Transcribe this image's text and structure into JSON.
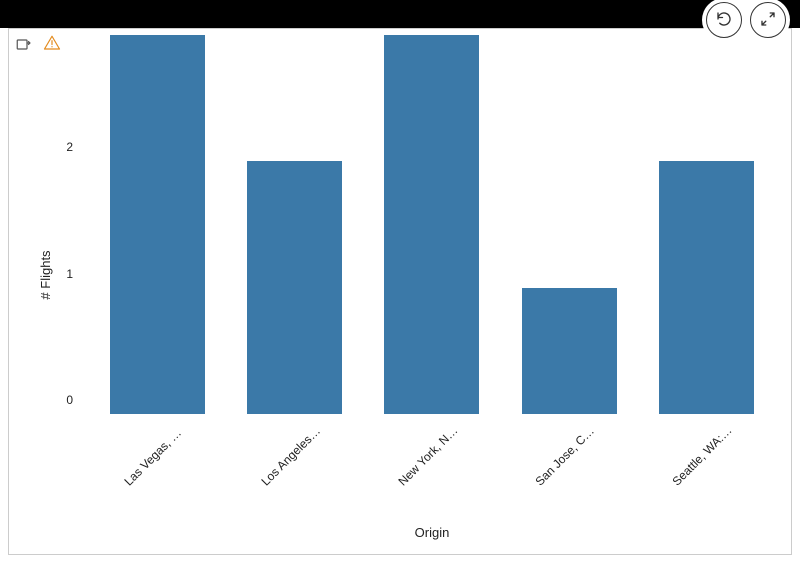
{
  "chart_data": {
    "type": "bar",
    "categories": [
      "Las Vegas, NV: McC...",
      "Los Angeles, CA: Lo...",
      "New York, NY: John ...",
      "San Jose, CA: Norm...",
      "Seattle, WA: Seattle..."
    ],
    "values": [
      3,
      2,
      3,
      1,
      2
    ],
    "xlabel": "Origin",
    "ylabel": "# Flights",
    "ylim": [
      0,
      3
    ],
    "y_ticks": [
      0,
      1,
      2
    ],
    "bar_color": "#3b79a8"
  },
  "toolbar": {
    "export_title": "Export",
    "warning_title": "Warning"
  },
  "top_actions": {
    "refresh_title": "Refresh",
    "fullscreen_title": "Fullscreen"
  }
}
